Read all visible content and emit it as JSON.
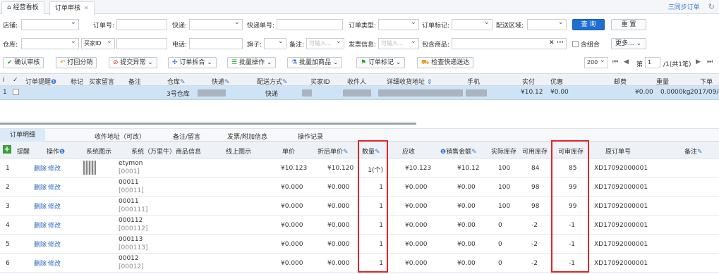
{
  "tabs": [
    {
      "label": "经营看板"
    },
    {
      "label": "订单审核"
    }
  ],
  "sync_label": "三同步订单",
  "filters": {
    "row1": {
      "store": "店铺:",
      "order_no": "订单号:",
      "express": "快递:",
      "express_no": "快递单号:",
      "order_type": "订单类型:",
      "order_flag": "订单标记:",
      "delivery_area": "配送区域:",
      "query": "查 询",
      "reset": "重 置"
    },
    "row2": {
      "warehouse": "仓库:",
      "buyer_id": "买家ID",
      "phone": "电话:",
      "flag": "旗子:",
      "remark": "备注:",
      "remark_placeholder": "可输入...",
      "invoice": "发票信息:",
      "invoice_placeholder": "可输入...",
      "contains_goods": "包含商品:",
      "combo": "含组合",
      "more": "更多..."
    }
  },
  "toolbar": {
    "approve": "确认审核",
    "split_back": "打回分销",
    "submit_exception": "提交异常",
    "merge_split": "订单拆合",
    "batch": "批量操作",
    "batch_add": "批量加商品",
    "order_mark": "订单标记",
    "check_express": "检查快递送达",
    "page_size": "200",
    "page_label": "第",
    "page_num": "1",
    "total": "/1(共1笔)"
  },
  "order_grid": {
    "headers": [
      "订单提醒",
      "标记",
      "买家留言",
      "备注",
      "仓库",
      "快递",
      "配送方式",
      "买家ID",
      "收件人",
      "详细收货地址",
      "手机",
      "实付",
      "优惠",
      "邮费",
      "重量",
      "下单"
    ],
    "row": {
      "index": "1",
      "warehouse": "3号仓库",
      "delivery": "快递",
      "paid": "¥10.12",
      "discount": "¥0.00",
      "postage": "¥0.00",
      "weight": "0.0000kg",
      "date": "2017/09/"
    }
  },
  "detail_tabs": [
    "订单明细",
    "收件地址（可改）",
    "备注/留言",
    "发票/附加信息",
    "操作记录"
  ],
  "detail": {
    "headers": {
      "remind": "提醒",
      "ops": "操作",
      "sys_img": "系统图示",
      "sys_info": "系统（万里牛）商品信息",
      "online_img": "线上图示",
      "unit_price": "单价",
      "disc_price": "折后单价",
      "qty": "数量",
      "receivable": "应收",
      "sale_amount": "销售金额",
      "actual_stock": "实际库存",
      "avail_stock": "可用库存",
      "approvable_stock": "可审库存",
      "orig_order": "原订单号",
      "remark": "备注"
    },
    "action_delete": "删除",
    "action_edit": "修改",
    "rows": [
      {
        "idx": "1",
        "name": "etymon",
        "code": "[0001]",
        "unit": "¥10.123",
        "disc": "¥10.120",
        "qty": "1(个)",
        "recv": "¥10.123",
        "sale": "¥10.12",
        "actual": "100",
        "avail": "84",
        "appr": "85",
        "orig": "XD17092000001"
      },
      {
        "idx": "2",
        "name": "00011",
        "code": "[00011]",
        "unit": "¥0.000",
        "disc": "¥0.000",
        "qty": "1",
        "recv": "¥0.000",
        "sale": "¥0.00",
        "actual": "100",
        "avail": "98",
        "appr": "99",
        "orig": "XD17092000001"
      },
      {
        "idx": "3",
        "name": "00011",
        "code": "[000111]",
        "unit": "¥0.000",
        "disc": "¥0.000",
        "qty": "1",
        "recv": "¥0.000",
        "sale": "¥0.00",
        "actual": "100",
        "avail": "98",
        "appr": "99",
        "orig": "XD17092000001"
      },
      {
        "idx": "4",
        "name": "000112",
        "code": "[000112]",
        "unit": "¥0.000",
        "disc": "¥0.000",
        "qty": "1",
        "recv": "¥0.000",
        "sale": "¥0.00",
        "actual": "0",
        "avail": "-2",
        "appr": "-1",
        "orig": "XD17092000001"
      },
      {
        "idx": "5",
        "name": "000113",
        "code": "[000113]",
        "unit": "¥0.000",
        "disc": "¥0.000",
        "qty": "1",
        "recv": "¥0.000",
        "sale": "¥0.00",
        "actual": "0",
        "avail": "-2",
        "appr": "-1",
        "orig": "XD17092000001"
      },
      {
        "idx": "6",
        "name": "00012",
        "code": "[00012]",
        "unit": "¥0.000",
        "disc": "¥0.000",
        "qty": "1",
        "recv": "¥0.000",
        "sale": "¥0.00",
        "actual": "0",
        "avail": "-2",
        "appr": "-1",
        "orig": "XD17092000001"
      }
    ]
  }
}
